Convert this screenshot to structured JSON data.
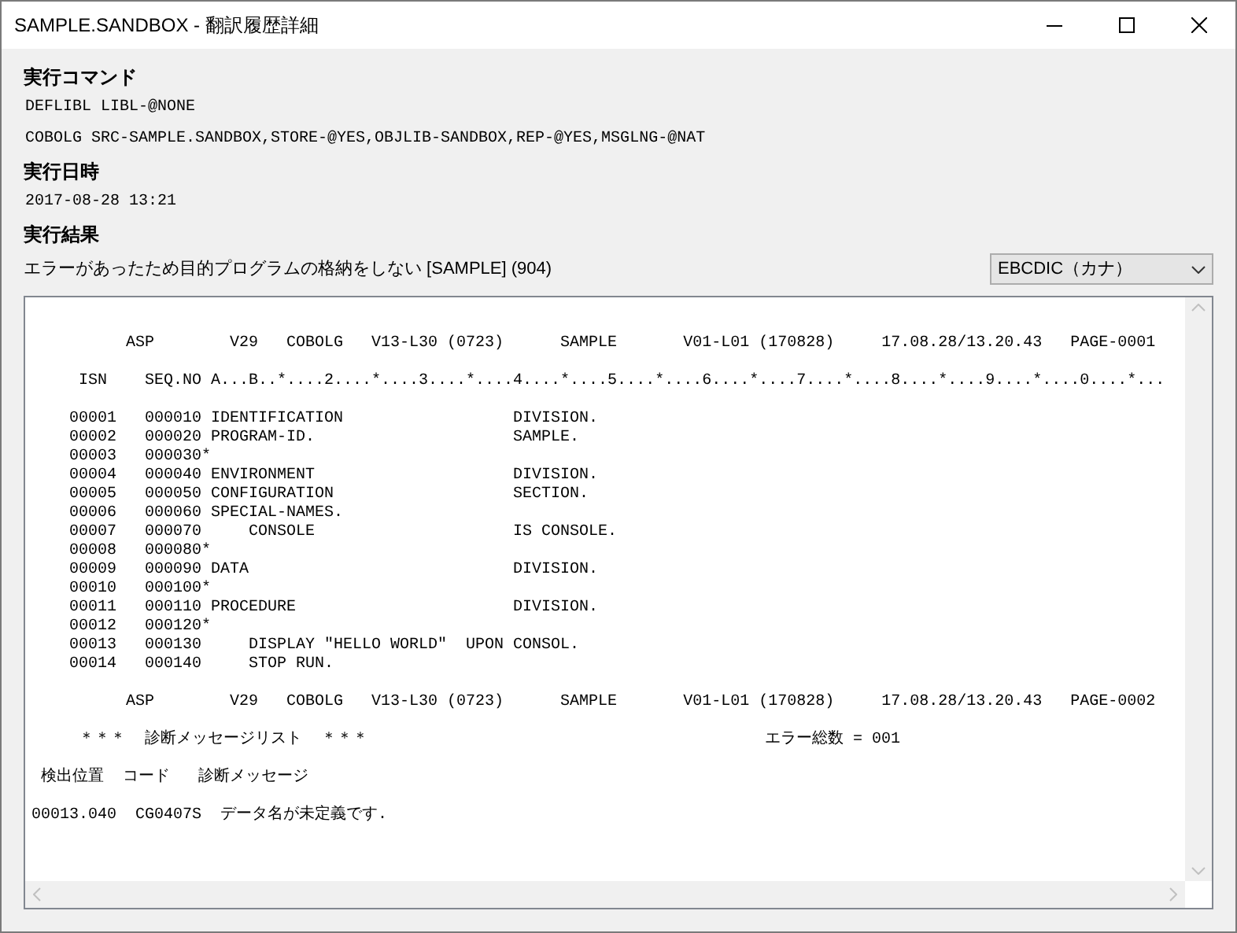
{
  "window": {
    "title": "SAMPLE.SANDBOX - 翻訳履歴詳細"
  },
  "sections": [
    {
      "label": "実行コマンド",
      "lines": [
        "DEFLIBL LIBL-@NONE",
        "COBOLG SRC-SAMPLE.SANDBOX,STORE-@YES,OBJLIB-SANDBOX,REP-@YES,MSGLNG-@NAT"
      ]
    },
    {
      "label": "実行日時",
      "lines": [
        "2017-08-28 13:21"
      ]
    },
    {
      "label": "実行結果"
    }
  ],
  "result_message": "エラーがあったため目的プログラムの格納をしない [SAMPLE] (904)",
  "encoding_select": {
    "value": "EBCDIC（カナ）"
  },
  "listing": [
    [
      "          ASP        V29   COBOLG   V13-L30 (0723)      SAMPLE       V01-L01 (170828)     17.08.28/13.20.43   PAGE-0001"
    ],
    [
      "     ISN    SEQ.NO A...B..*....2....*....3....*....4....*....5....*....6....*....7....*....8....*....9....*....0....*..."
    ],
    [
      "    00001   000010 IDENTIFICATION                  DIVISION.",
      "    00002   000020 PROGRAM-ID.                     SAMPLE.",
      "    00003   000030*",
      "    00004   000040 ENVIRONMENT                     DIVISION.",
      "    00005   000050 CONFIGURATION                   SECTION.",
      "    00006   000060 SPECIAL-NAMES.",
      "    00007   000070     CONSOLE                     IS CONSOLE.",
      "    00008   000080*",
      "    00009   000090 DATA                            DIVISION.",
      "    00010   000100*",
      "    00011   000110 PROCEDURE                       DIVISION.",
      "    00012   000120*",
      "    00013   000130     DISPLAY \"HELLO WORLD\"  UPON CONSOL.",
      "    00014   000140     STOP RUN."
    ],
    [
      "          ASP        V29   COBOLG   V13-L30 (0723)      SAMPLE       V01-L01 (170828)     17.08.28/13.20.43   PAGE-0002"
    ],
    [
      "     ＊＊＊  診断メッセージリスト  ＊＊＊                                          エラー総数 = 001"
    ],
    [
      " 検出位置  コード   診断メッセージ"
    ],
    [
      "00013.040  CG0407S  データ名が未定義です."
    ]
  ]
}
